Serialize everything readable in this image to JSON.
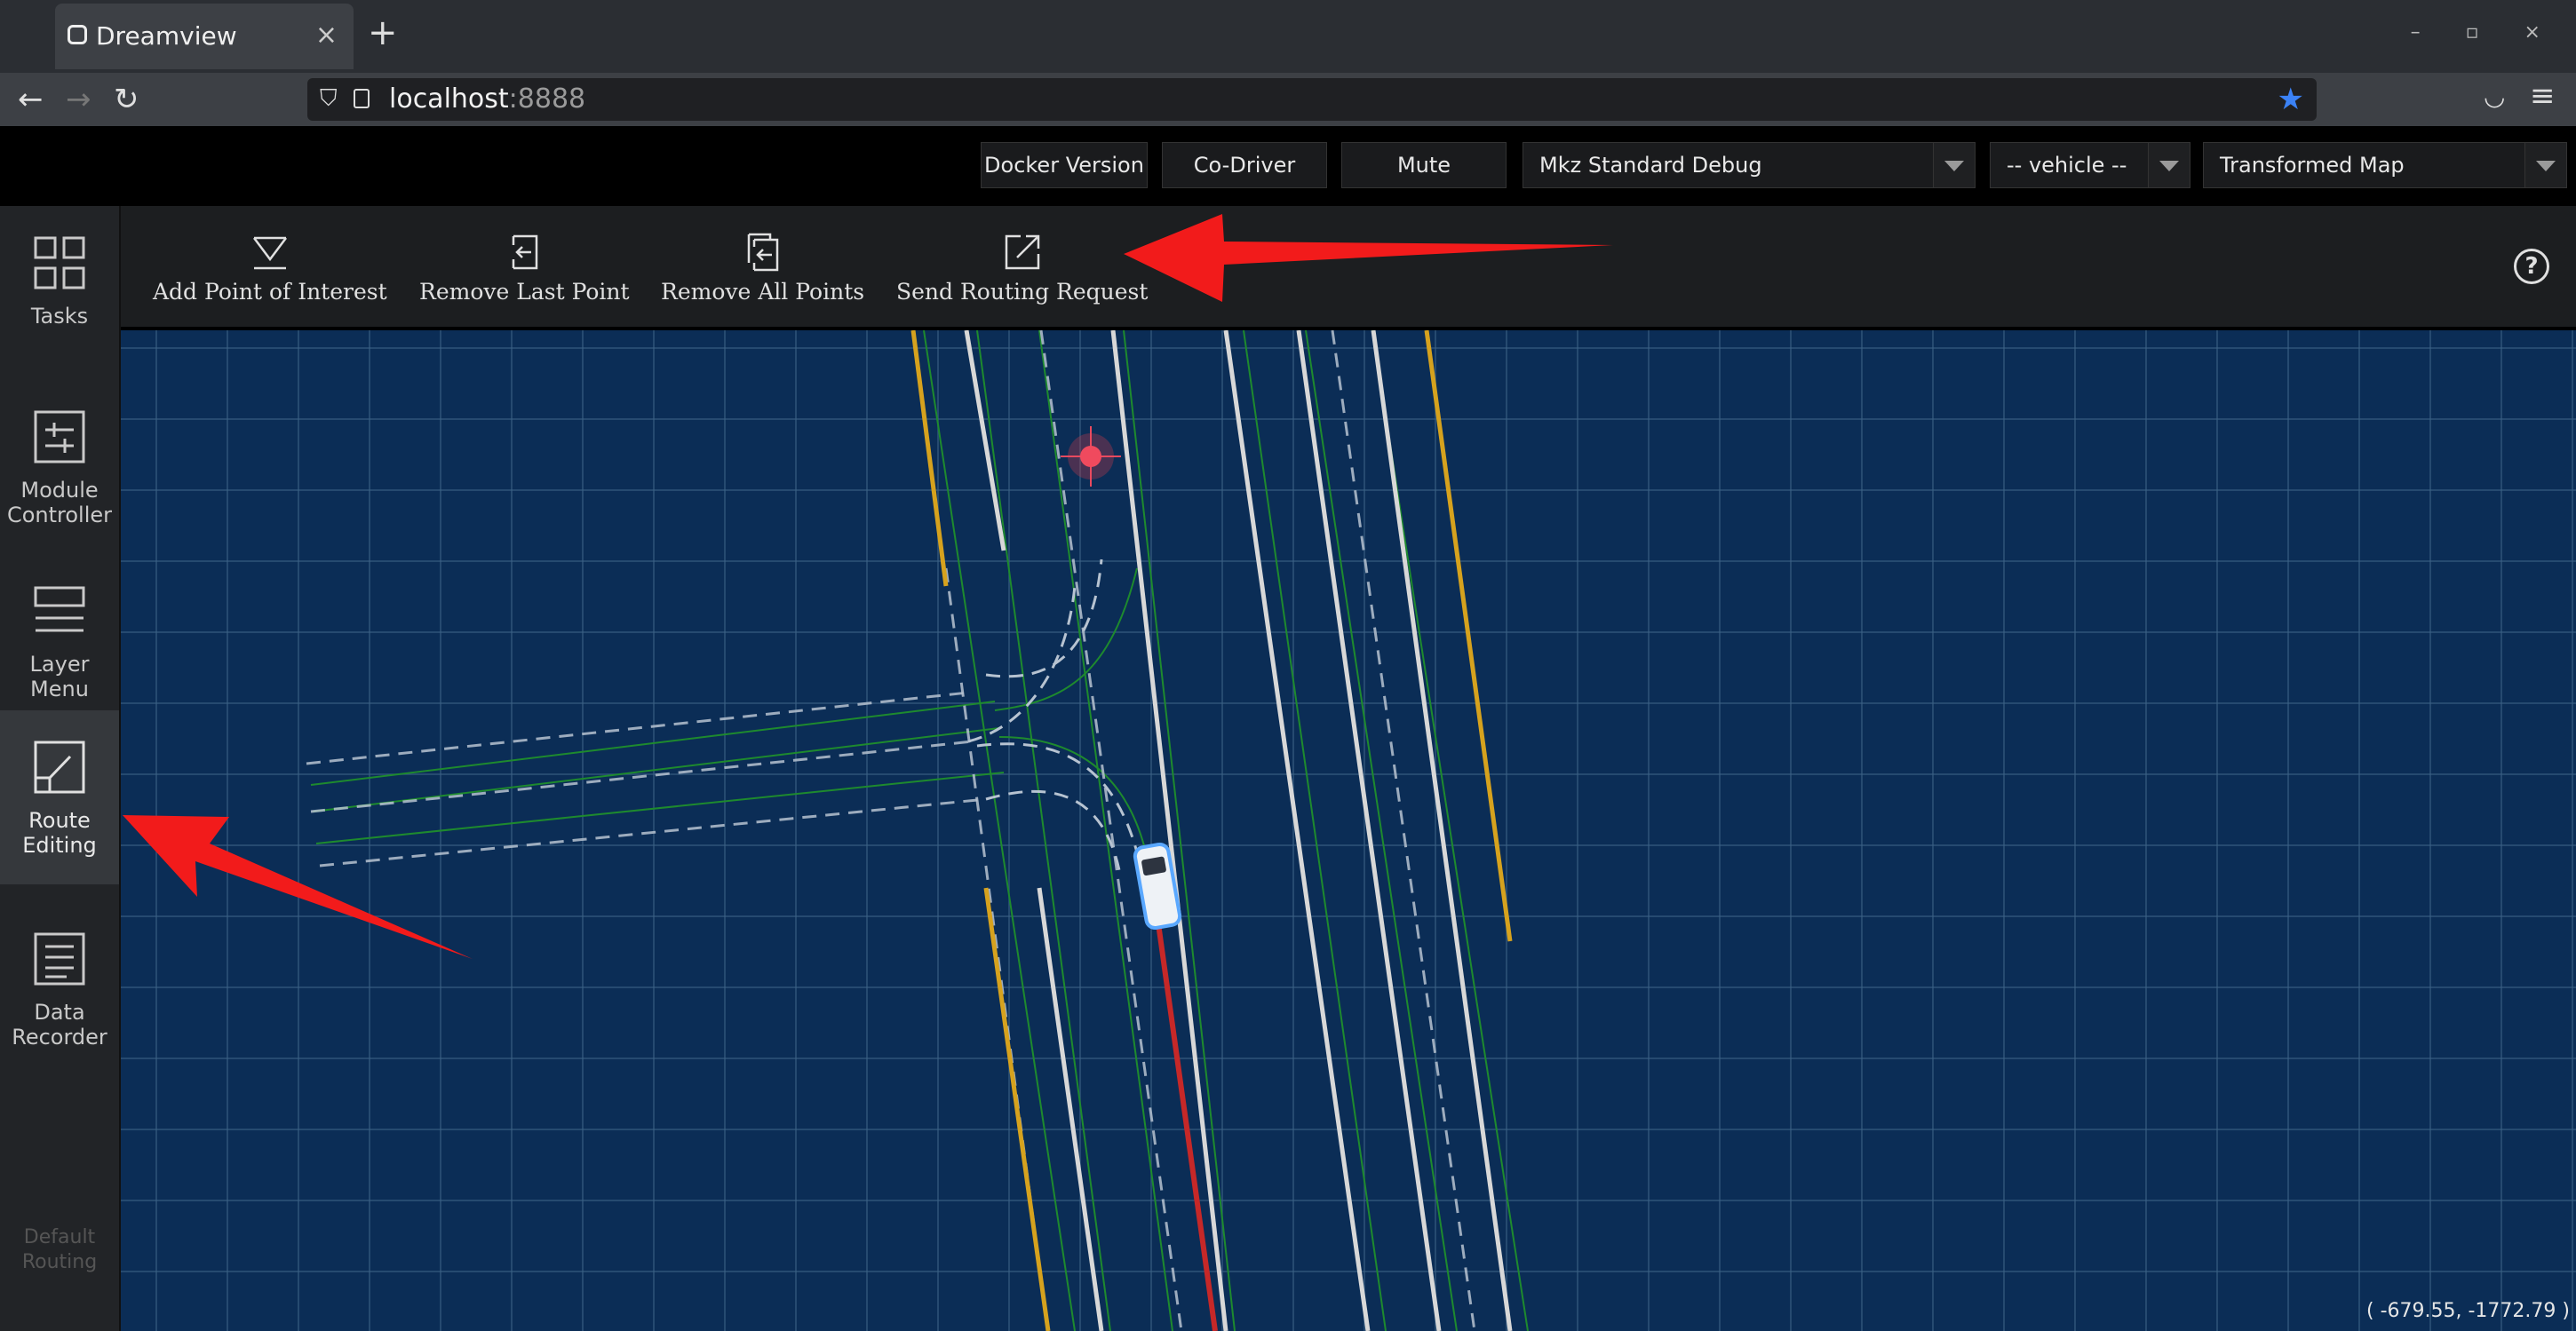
{
  "browser": {
    "tab_title": "Dreamview",
    "tab_close": "×",
    "new_tab": "+",
    "window_controls": "– ▫ ×",
    "url_host": "localhost",
    "url_port": ":8888"
  },
  "header": {
    "docker_version": "Docker Version",
    "co_driver": "Co-Driver",
    "mute": "Mute",
    "mode_select": "Mkz Standard Debug",
    "vehicle_select": "-- vehicle --",
    "map_select": "Transformed Map"
  },
  "sidebar": {
    "items": [
      {
        "label": "Tasks"
      },
      {
        "label": "Module Controller"
      },
      {
        "label": "Layer Menu"
      },
      {
        "label": "Route Editing"
      },
      {
        "label": "Data Recorder"
      }
    ],
    "default_routing": "Default Routing"
  },
  "toolbar": {
    "add_poi": "Add Point of Interest",
    "remove_last": "Remove Last Point",
    "remove_all": "Remove All Points",
    "send_routing": "Send Routing Request",
    "help": "?"
  },
  "map": {
    "coordinates": "( -679.55, -1772.79 )"
  },
  "colors": {
    "map_bg": "#0b2d56",
    "grid": "#3f6488",
    "lane_white": "#d8d8d8",
    "lane_yellow": "#d6a21e",
    "lane_green": "#1e8a2e",
    "route_red": "#c62828",
    "annotation_red": "#f21b1b",
    "star_blue": "#3b82f6"
  }
}
